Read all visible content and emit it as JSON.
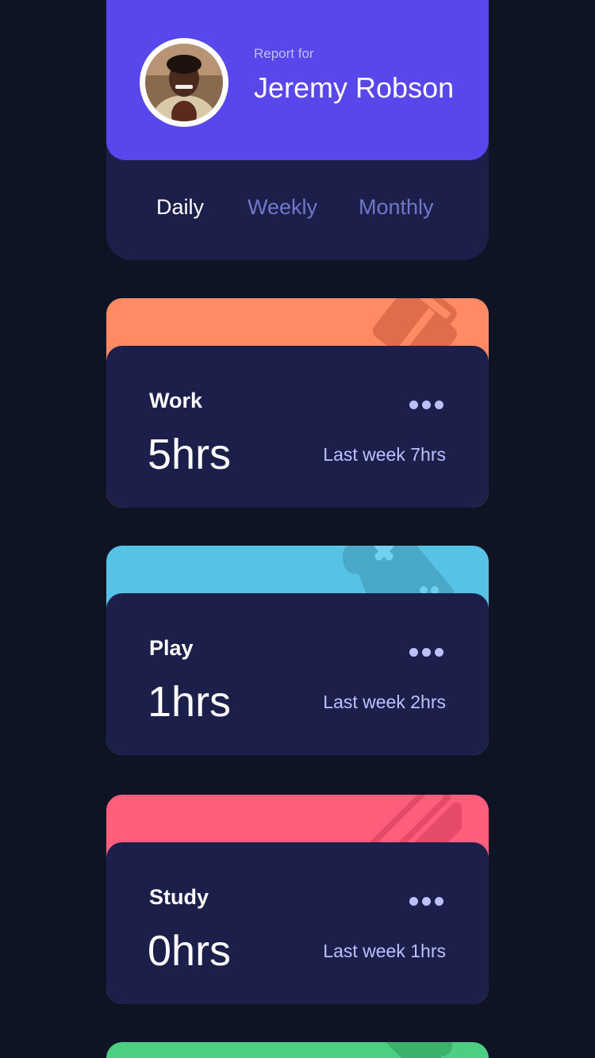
{
  "profile": {
    "report_for": "Report for",
    "name": "Jeremy Robson",
    "avatar_icon": "avatar-photo",
    "accent": "#5847eb"
  },
  "tabs": [
    {
      "label": "Daily",
      "active": true
    },
    {
      "label": "Weekly",
      "active": false
    },
    {
      "label": "Monthly",
      "active": false
    }
  ],
  "cards": [
    {
      "title": "Work",
      "hours": "5hrs",
      "last_week": "Last week 7hrs",
      "color": "#ff8b64",
      "icon": "briefcase-icon"
    },
    {
      "title": "Play",
      "hours": "1hrs",
      "last_week": "Last week 2hrs",
      "color": "#55c2e6",
      "icon": "gamepad-icon"
    },
    {
      "title": "Study",
      "hours": "0hrs",
      "last_week": "Last week 1hrs",
      "color": "#ff5e7d",
      "icon": "book-icon"
    }
  ],
  "partial_card": {
    "color": "#4bcf82",
    "icon": "exercise-icon"
  },
  "colors": {
    "page_bg": "#0f1424",
    "card_bg": "#1c1f4a",
    "muted_text": "#bbc0ff",
    "inactive_tab": "#7078c9"
  }
}
